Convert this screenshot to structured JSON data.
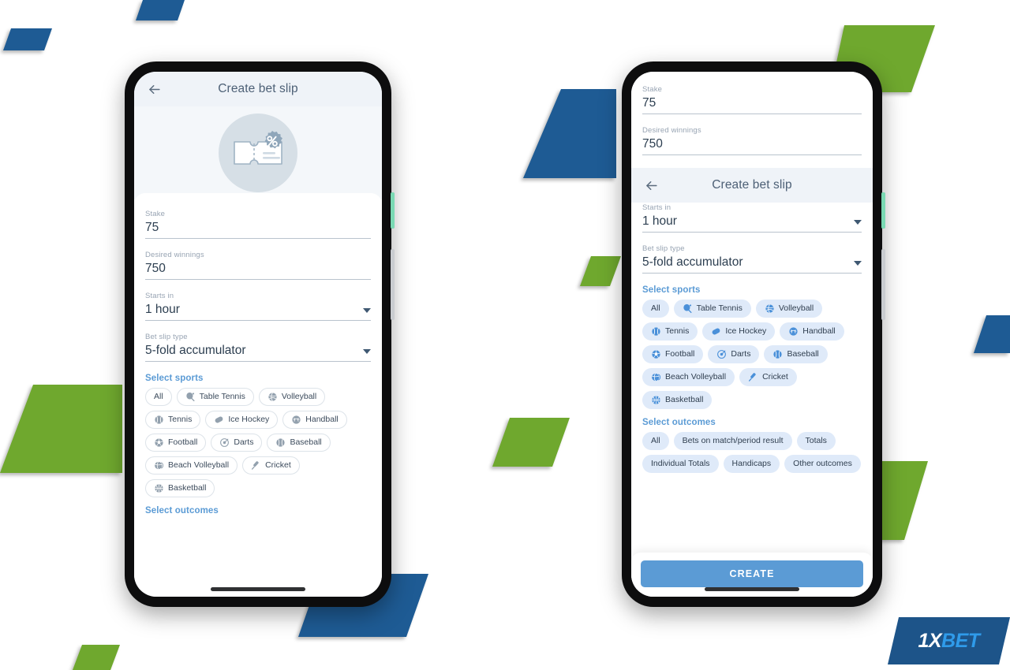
{
  "brand": {
    "logo_primary": "1X",
    "logo_secondary": "BET",
    "logo_primary_color": "#ffffff",
    "logo_secondary_color": "#2f9bea",
    "logo_plate_color": "#1d5489"
  },
  "palette": {
    "accent_blue": "#5b9bd5",
    "deco_blue": "#1e5b94",
    "deco_green": "#6fa82e",
    "header_bg": "#eff3f8",
    "chip_blue_bg": "#dfeaf9",
    "icon_grey": "#93a1ae",
    "icon_blue": "#4a90d9",
    "text_dark": "#2c3e50",
    "label_grey": "#98a4b3"
  },
  "left_phone": {
    "header": {
      "back_icon": "back-arrow-icon",
      "title": "Create bet slip"
    },
    "hero_icon": "bet-slip-ticket-percent-icon",
    "fields": [
      {
        "label": "Stake",
        "value": "75",
        "type": "text"
      },
      {
        "label": "Desired winnings",
        "value": "750",
        "type": "text"
      },
      {
        "label": "Starts in",
        "value": "1 hour",
        "type": "select"
      },
      {
        "label": "Bet slip type",
        "value": "5-fold accumulator",
        "type": "select"
      }
    ],
    "sports_section_title": "Select sports",
    "sports": [
      {
        "label": "All",
        "icon": null
      },
      {
        "label": "Table Tennis",
        "icon": "table-tennis-icon"
      },
      {
        "label": "Volleyball",
        "icon": "volleyball-icon"
      },
      {
        "label": "Tennis",
        "icon": "tennis-ball-icon"
      },
      {
        "label": "Ice Hockey",
        "icon": "ice-hockey-puck-icon"
      },
      {
        "label": "Handball",
        "icon": "handball-icon"
      },
      {
        "label": "Football",
        "icon": "football-icon"
      },
      {
        "label": "Darts",
        "icon": "darts-icon"
      },
      {
        "label": "Baseball",
        "icon": "baseball-icon"
      },
      {
        "label": "Beach Volleyball",
        "icon": "beach-volleyball-icon"
      },
      {
        "label": "Cricket",
        "icon": "cricket-bat-icon"
      },
      {
        "label": "Basketball",
        "icon": "basketball-icon"
      }
    ],
    "outcomes_section_title": "Select outcomes"
  },
  "right_phone": {
    "floating_header": {
      "back_icon": "back-arrow-icon",
      "title": "Create bet slip"
    },
    "fields": [
      {
        "label": "Stake",
        "value": "75",
        "type": "text"
      },
      {
        "label": "Desired winnings",
        "value": "750",
        "type": "text"
      },
      {
        "label": "Starts in",
        "value": "1 hour",
        "type": "select"
      },
      {
        "label": "Bet slip type",
        "value": "5-fold accumulator",
        "type": "select"
      }
    ],
    "sports_section_title": "Select sports",
    "sports": [
      {
        "label": "All",
        "icon": null
      },
      {
        "label": "Table Tennis",
        "icon": "table-tennis-icon"
      },
      {
        "label": "Volleyball",
        "icon": "volleyball-icon"
      },
      {
        "label": "Tennis",
        "icon": "tennis-ball-icon"
      },
      {
        "label": "Ice Hockey",
        "icon": "ice-hockey-puck-icon"
      },
      {
        "label": "Handball",
        "icon": "handball-icon"
      },
      {
        "label": "Football",
        "icon": "football-icon"
      },
      {
        "label": "Darts",
        "icon": "darts-icon"
      },
      {
        "label": "Baseball",
        "icon": "baseball-icon"
      },
      {
        "label": "Beach Volleyball",
        "icon": "beach-volleyball-icon"
      },
      {
        "label": "Cricket",
        "icon": "cricket-bat-icon"
      },
      {
        "label": "Basketball",
        "icon": "basketball-icon"
      }
    ],
    "outcomes_section_title": "Select outcomes",
    "outcomes": [
      {
        "label": "All"
      },
      {
        "label": "Bets on match/period result"
      },
      {
        "label": "Totals"
      },
      {
        "label": "Individual Totals"
      },
      {
        "label": "Handicaps"
      },
      {
        "label": "Other outcomes"
      }
    ],
    "cta_label": "CREATE"
  }
}
